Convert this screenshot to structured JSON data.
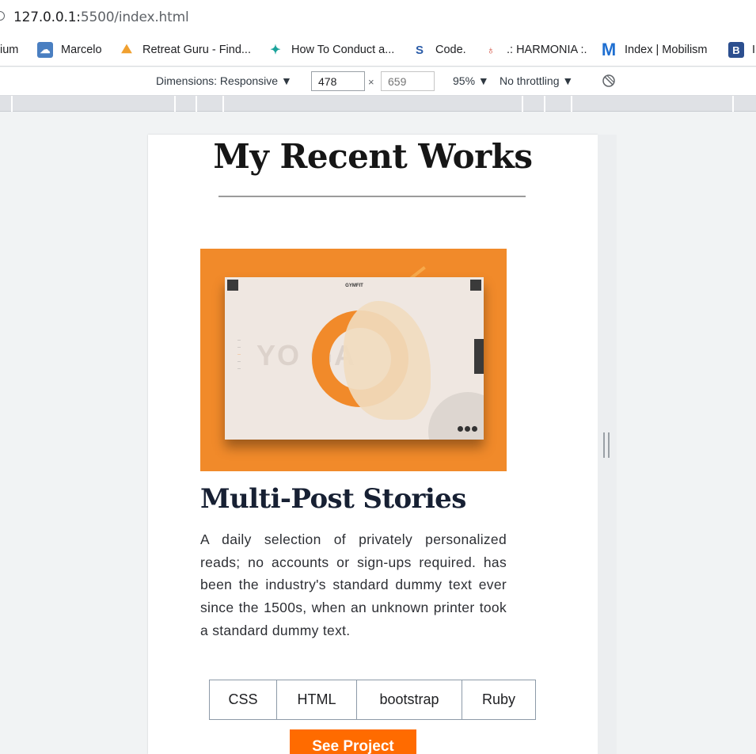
{
  "browser": {
    "url_host": "127.0.0.1:",
    "url_path": "5500/index.html",
    "bookmarks": [
      {
        "label": "ium",
        "icon": "bookmark-icon"
      },
      {
        "label": "Marcelo",
        "icon": "cloud-icon"
      },
      {
        "label": "Retreat Guru - Find...",
        "icon": "retreat-icon"
      },
      {
        "label": "How To Conduct a...",
        "icon": "star-icon"
      },
      {
        "label": "Code.",
        "icon": "code-icon"
      },
      {
        "label": ".: HARMONIA :.",
        "icon": "harmonia-icon"
      },
      {
        "label": "Index | Mobilism",
        "icon": "mobilism-icon"
      },
      {
        "label": "I",
        "icon": "b-icon"
      }
    ]
  },
  "devtools": {
    "dimensions_label": "Dimensions: Responsive ▼",
    "width_value": "478",
    "height_placeholder": "659",
    "times": "×",
    "zoom": "95% ▼",
    "throttling": "No throttling ▼"
  },
  "page": {
    "title": "My Recent Works",
    "card": {
      "image_alt": "GYMFIT yoga website mockup",
      "mock_logo": "GYMFIT",
      "mock_bigtext": "YO     GA",
      "title": "Multi-Post Stories",
      "description": "A daily selection of privately personalized reads; no accounts or sign-ups required. has been the industry's standard dummy text ever since the 1500s, when an unknown printer took a standard dummy text.",
      "tags": [
        "CSS",
        "HTML",
        "bootstrap",
        "Ruby"
      ],
      "button_label": "See Project"
    }
  },
  "colors": {
    "accent": "#ff6b00",
    "image_bg": "#f18a2a",
    "title_text": "#172033"
  }
}
